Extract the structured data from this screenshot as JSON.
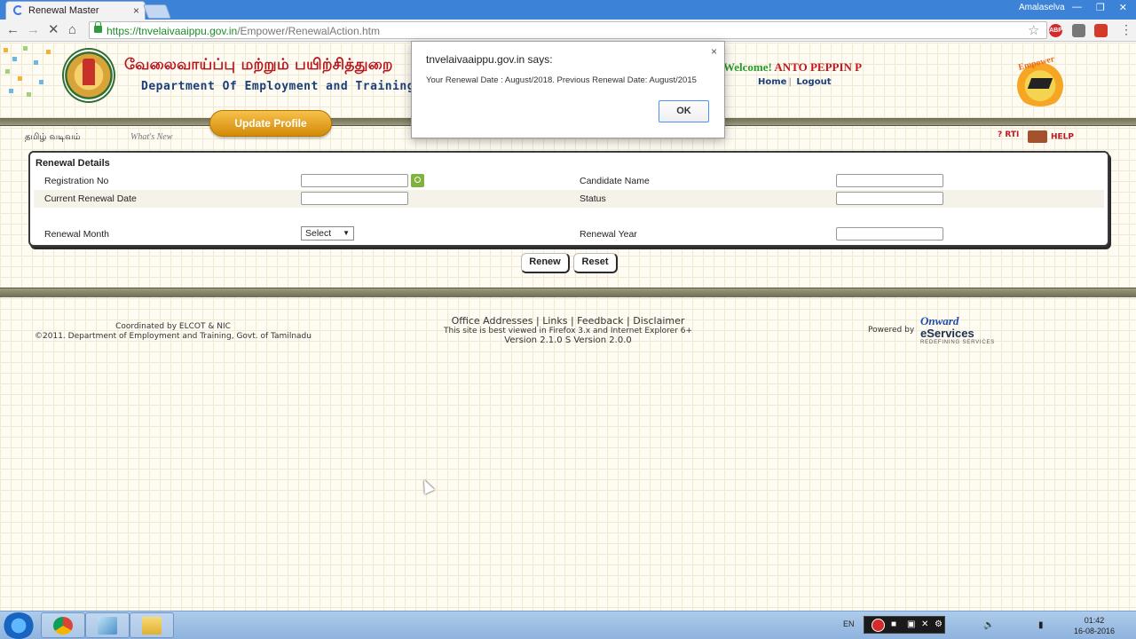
{
  "browser": {
    "tab_title": "Renewal Master",
    "tab_close": "×",
    "window_user": "Amalaselva",
    "window_buttons": [
      "—",
      "❐",
      "✕"
    ],
    "url_host": "https://tnvelaivaaippu.gov.in",
    "url_path": "/Empower/RenewalAction.htm",
    "ext_abp": "ABP"
  },
  "header": {
    "tamil_title": "வேலைவாய்ப்பு மற்றும் பயிற்சித்துறை",
    "dept_title": "Department Of Employment and Training",
    "welcome_prefix": "Welcome!",
    "welcome_name": "ANTO PEPPIN P",
    "home_link": "Home",
    "logout_link": "Logout",
    "empower_logo_text": "Empower",
    "update_profile": "Update Profile",
    "subnav_tamil": "தமிழ் வடிவம்",
    "subnav_whats_new": "What's New",
    "rti": "RTI",
    "help": "HELP"
  },
  "form": {
    "section_title": "Renewal Details",
    "registration_no_label": "Registration No",
    "registration_no_value": "",
    "candidate_name_label": "Candidate Name",
    "candidate_name_value": "",
    "current_renewal_date_label": "Current Renewal Date",
    "current_renewal_date_value": "",
    "status_label": "Status",
    "status_value": "",
    "renewal_month_label": "Renewal Month",
    "renewal_month_selected": "Select",
    "renewal_year_label": "Renewal Year",
    "renewal_year_value": "",
    "renew_button": "Renew",
    "reset_button": "Reset"
  },
  "footer": {
    "coordinated": "Coordinated by ELCOT & NIC",
    "copyright": "©2011. Department of Employment and Training, Govt. of Tamilnadu",
    "links": "Office Addresses | Links | Feedback | Disclaimer",
    "browser_note": "This site is best viewed in Firefox 3.x and Internet Explorer 6+",
    "version": "Version 2.1.0 S Version 2.0.0",
    "powered_by": "Powered by",
    "onward_1": "Onward",
    "onward_2": "eServices",
    "onward_3": "REDEFINING SERVICES"
  },
  "alert": {
    "title": "tnvelaivaaippu.gov.in says:",
    "message": "Your Renewal Date :  August/2018. Previous Renewal Date: August/2015",
    "ok_button": "OK",
    "close": "×"
  },
  "taskbar": {
    "language": "EN",
    "time": "01:42",
    "date": "16-08-2016"
  },
  "colors": {
    "accent_red": "#c1171d",
    "accent_blue": "#1c3f7a",
    "update_button": "#e8a21c"
  }
}
